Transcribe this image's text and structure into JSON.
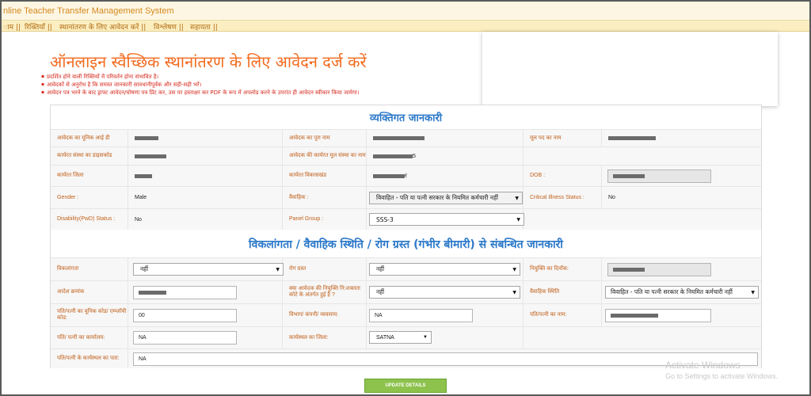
{
  "app": {
    "title": "nline Teacher Transfer Management System"
  },
  "menu": [
    {
      "label": "ाम ||"
    },
    {
      "label": "रिक्तियाँ ||"
    },
    {
      "label": "स्थानांतरण के लिए आवेदन करें ||"
    },
    {
      "label": "विश्लेषण ||"
    },
    {
      "label": "सहायता ||"
    }
  ],
  "heading": "ऑनलाइन स्वैच्छिक स्थानांतरण के लिए आवेदन दर्ज करें",
  "notes": [
    "प्रदर्शित होने वाली रिक्तियों में परिवर्तन होना संभावित है।",
    "आवेदकों से अनुरोध है कि समस्त जानकारी सावधानीपूर्वक और सही-सही भरें।",
    "आवेदन पत्र भरने के बाद ड्राफ्ट आवेदन/घोषणा पत्र प्रिंट कर, उस पर हस्ताक्षर कर PDF के रूप में अपलोड करने के उपरांत ही आवेदन स्वीकार किया जायेगा।"
  ],
  "personal": {
    "section_title": "व्यक्तिगत जानकारी",
    "unique_id_label": "आवेदक का यूनिक आई डी",
    "full_name_label": "आवेदक का पूरा नाम",
    "post_label": "मूल पद का नाम",
    "school_code_label": "कार्यरत संस्था का डाइसकोड",
    "school_name_label": "आवेदक की कार्यरत मूल संस्था का नाम",
    "school_name_suffix": "5",
    "district_label": "कार्यरत जिला",
    "block_label": "कार्यरत विकासखंड",
    "block_suffix": "र",
    "dob_label": "DOB :",
    "gender_label": "Gender :",
    "gender_value": "Male",
    "marital_label": "वैवाहिक :",
    "marital_value": "विवाहित - पति या पत्नी सरकार के नियमित कर्मचारी नहीं",
    "critical_label": "Critical Illness Status :",
    "critical_value": "No",
    "disability_label": "Disability(PwD) Status :",
    "disability_value": "No",
    "panel_label": "Panel Group :",
    "panel_value": "SSS-3"
  },
  "related": {
    "section_title": "विकलांगता / वैवाहिक स्थिति / रोग ग्रस्त (गंभीर बीमारी) से संबन्धित जानकारी",
    "disability_label": "विकलांगता",
    "disability_value": "नहीं",
    "illness_label": "रोग ग्रस्त",
    "illness_value": "नहीं",
    "appointment_date_label": "नियुक्ति का दिनाँक:",
    "order_no_label": "आदेश क्रमांक",
    "quota_label": "क्या आवेदक की नियुक्ति नि:शक्तता कोटे के अंतर्गत हुई है ?",
    "quota_value": "नहीं",
    "marital_label": "वैवाहिक स्थिति",
    "marital_value": "विवाहित - पति या पत्नी सरकार के नियमित कर्मचारी नहीं",
    "spouse_code_label": "पति/पत्नी का यूनिक कोड/ एम्प्लॉयी कोड:",
    "spouse_code_value": "00",
    "dept_label": "विभाग/ कंपनी/ व्यवसाय:",
    "dept_value": "NA",
    "spouse_name_label": "पति/पत्नी का नाम:",
    "spouse_office_label": "पति/ पत्नी का कार्यालय:",
    "spouse_office_value": "NA",
    "workplace_district_label": "कार्यस्थल का जिला:",
    "workplace_district_value": "SATNA",
    "workplace_address_label": "पति/पत्नी के कार्यस्थल का पता:",
    "workplace_address_value": "NA"
  },
  "update_button": "UPDATE DETAILS",
  "watermark": {
    "line1": "Activate Windows",
    "line2": "Go to Settings to activate Windows."
  }
}
